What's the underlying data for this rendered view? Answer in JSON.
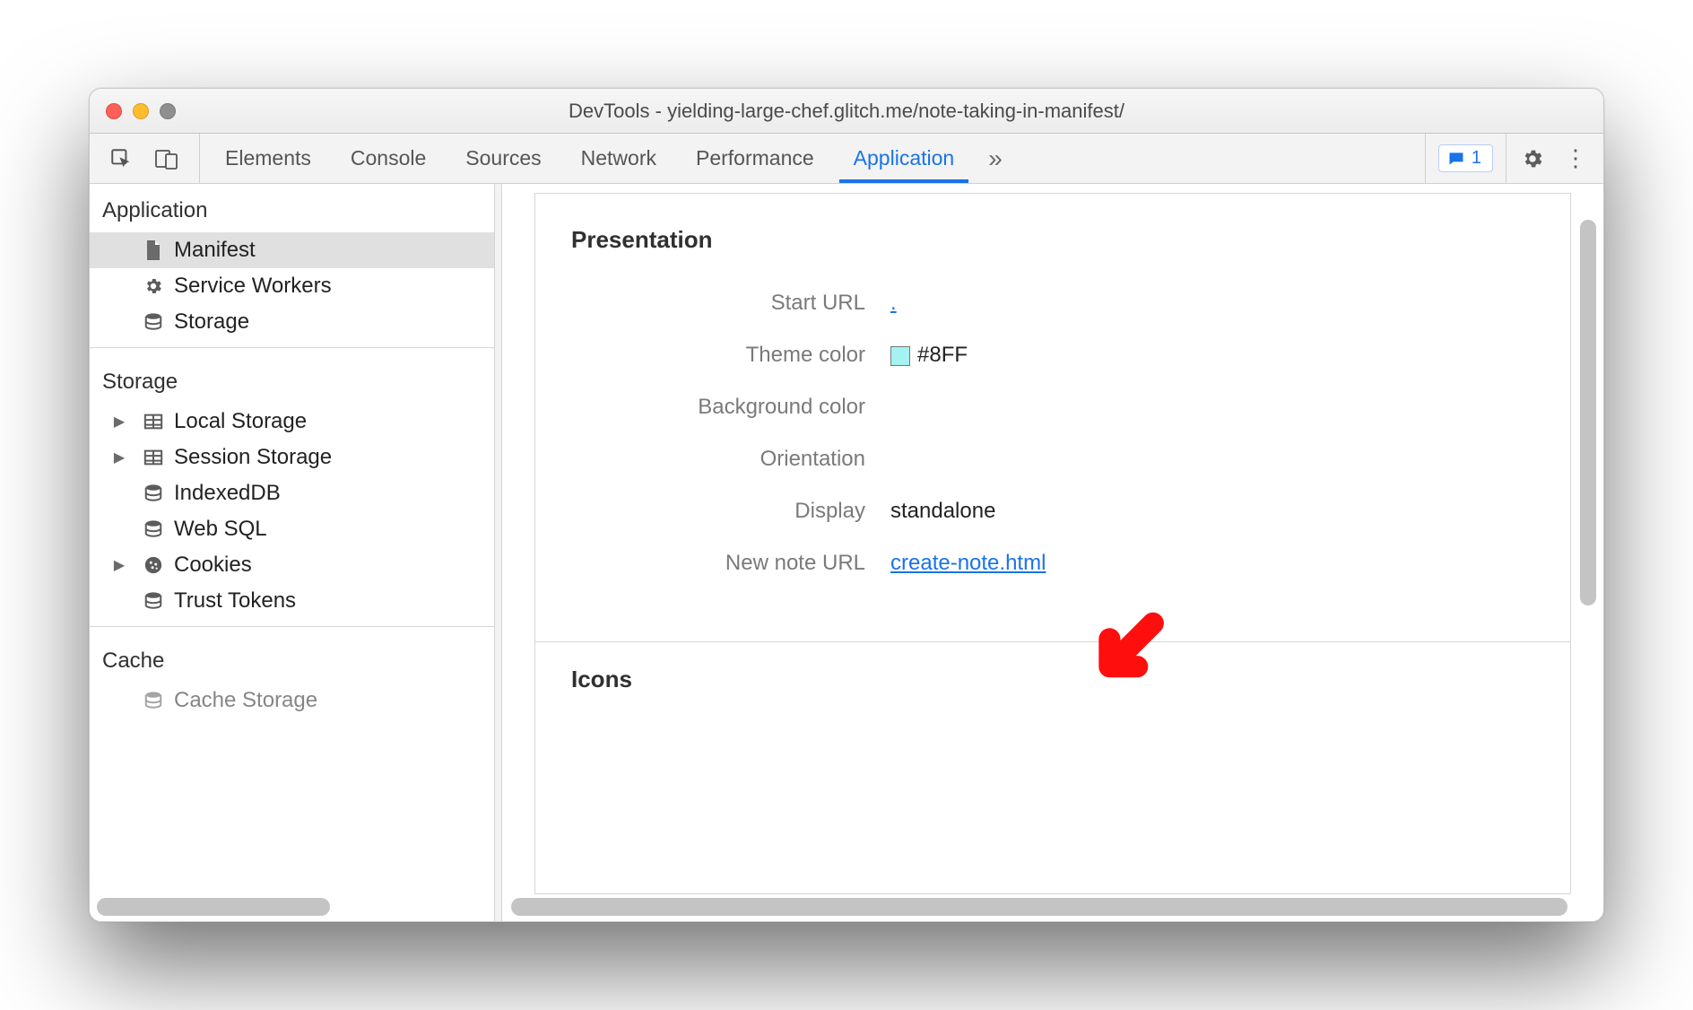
{
  "window": {
    "title": "DevTools - yielding-large-chef.glitch.me/note-taking-in-manifest/"
  },
  "tabs": {
    "items": [
      "Elements",
      "Console",
      "Sources",
      "Network",
      "Performance",
      "Application"
    ],
    "active": "Application",
    "overflow": "»"
  },
  "toolbar": {
    "message_count": "1"
  },
  "sidebar": {
    "groups": [
      {
        "title": "Application",
        "items": [
          {
            "icon": "file-icon",
            "label": "Manifest",
            "selected": true
          },
          {
            "icon": "gear-icon",
            "label": "Service Workers"
          },
          {
            "icon": "storage-icon",
            "label": "Storage"
          }
        ]
      },
      {
        "title": "Storage",
        "items": [
          {
            "tw": true,
            "icon": "table-icon",
            "label": "Local Storage"
          },
          {
            "tw": true,
            "icon": "table-icon",
            "label": "Session Storage"
          },
          {
            "icon": "storage-icon",
            "label": "IndexedDB"
          },
          {
            "icon": "storage-icon",
            "label": "Web SQL"
          },
          {
            "tw": true,
            "icon": "cookie-icon",
            "label": "Cookies"
          },
          {
            "icon": "storage-icon",
            "label": "Trust Tokens"
          }
        ]
      },
      {
        "title": "Cache",
        "items": [
          {
            "icon": "storage-icon",
            "label": "Cache Storage"
          }
        ]
      }
    ]
  },
  "content": {
    "section1_heading": "Presentation",
    "rows": {
      "start_url": {
        "label": "Start URL",
        "value": "."
      },
      "theme_color": {
        "label": "Theme color",
        "value": "#8FF",
        "swatch": "#a4f2f2"
      },
      "background_color": {
        "label": "Background color",
        "value": ""
      },
      "orientation": {
        "label": "Orientation",
        "value": ""
      },
      "display": {
        "label": "Display",
        "value": "standalone"
      },
      "new_note_url": {
        "label": "New note URL",
        "value": "create-note.html"
      }
    },
    "section2_heading": "Icons"
  }
}
